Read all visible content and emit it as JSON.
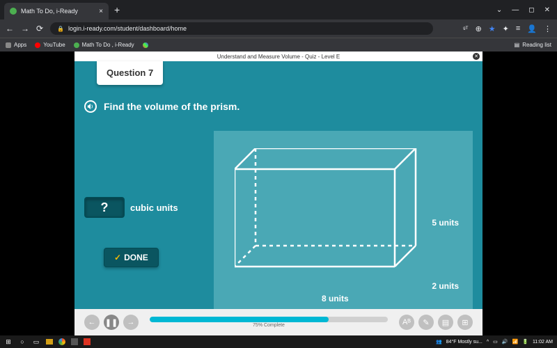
{
  "browser": {
    "tab_title": "Math To Do, i-Ready",
    "url": "login.i-ready.com/student/dashboard/home",
    "bookmarks": {
      "apps": "Apps",
      "youtube": "YouTube",
      "iready": "Math To Do , i-Ready",
      "reading": "Reading list"
    }
  },
  "quiz": {
    "header_title": "Understand and Measure Volume - Quiz - Level E",
    "question_label": "Question 7",
    "prompt": "Find the volume of the prism.",
    "answer_placeholder": "?",
    "answer_unit": "cubic units",
    "done_label": "DONE",
    "dimensions": {
      "height": "5 units",
      "depth": "2 units",
      "width": "8 units"
    },
    "progress_pct": 75,
    "progress_label": "75% Complete"
  },
  "taskbar": {
    "weather": "84°F Mostly su...",
    "time": "11:02 AM"
  }
}
